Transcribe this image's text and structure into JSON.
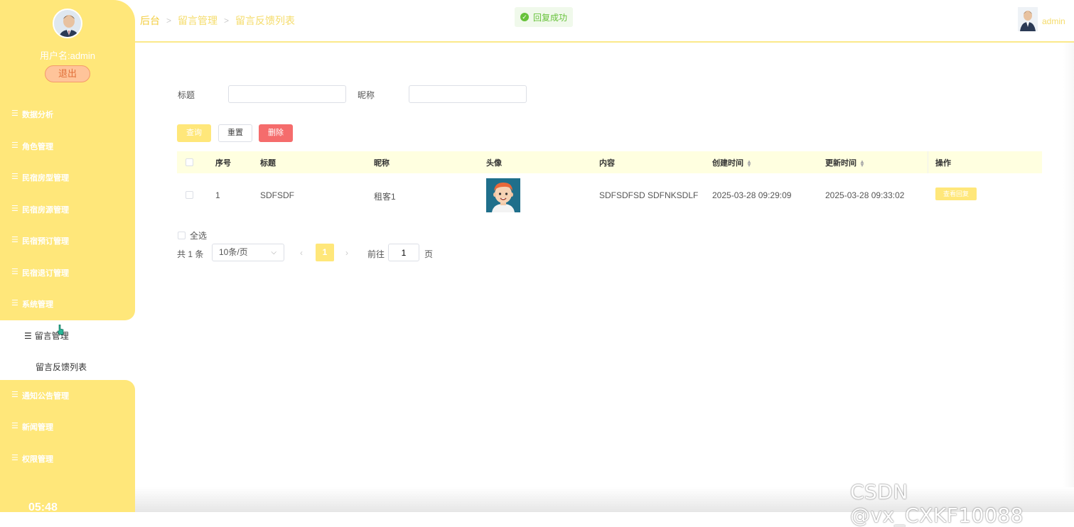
{
  "sidebar": {
    "username": "用户名:admin",
    "logout_label": "退出",
    "menu": [
      {
        "label": "数据分析"
      },
      {
        "label": "角色管理"
      },
      {
        "label": "民宿房型管理"
      },
      {
        "label": "民宿房源管理"
      },
      {
        "label": "民宿预订管理"
      },
      {
        "label": "民宿退订管理"
      },
      {
        "label": "系统管理"
      }
    ],
    "active_group": "留言管理",
    "active_item": "留言反馈列表",
    "menu_after": [
      {
        "label": "通知公告管理"
      },
      {
        "label": "新闻管理"
      },
      {
        "label": "权限管理"
      }
    ],
    "clock": "05:48"
  },
  "header": {
    "breadcrumb": [
      "后台",
      "留言管理",
      "留言反馈列表"
    ],
    "toast": "回复成功",
    "user": "admin"
  },
  "search": {
    "title_label": "标题",
    "title_value": "",
    "nickname_label": "昵称",
    "nickname_value": "",
    "query_label": "查询",
    "reset_label": "重置",
    "delete_label": "删除"
  },
  "table": {
    "columns": [
      "序号",
      "标题",
      "昵称",
      "头像",
      "内容",
      "创建时间",
      "更新时间",
      "操作"
    ],
    "rows": [
      {
        "index": "1",
        "title": "SDFSDF",
        "nickname": "租客1",
        "content": "SDFSDFSD SDFNKSDLF",
        "created": "2025-03-28 09:29:09",
        "updated": "2025-03-28 09:33:02",
        "action": "查看回复"
      }
    ]
  },
  "footer": {
    "select_all": "全选",
    "total": "共 1 条",
    "page_size": "10条/页",
    "current_page": "1",
    "goto_label": "前往",
    "goto_value": "1",
    "page_suffix": "页"
  },
  "watermark": "CSDN @vx_CXKF10088",
  "colors": {
    "accent": "#ffe77a",
    "danger": "#f56c6c",
    "success": "#67c23a"
  }
}
